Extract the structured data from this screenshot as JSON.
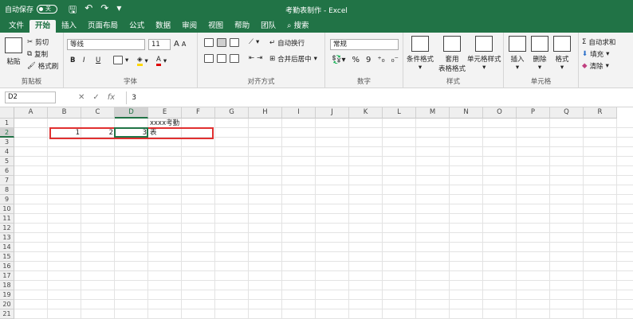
{
  "titlebar": {
    "autosave": "自动保存",
    "toggle": "关",
    "title": "考勤表制作 - Excel"
  },
  "tabs": [
    "文件",
    "开始",
    "插入",
    "页面布局",
    "公式",
    "数据",
    "审阅",
    "视图",
    "帮助",
    "团队",
    "搜索"
  ],
  "clipboard": {
    "paste": "粘贴",
    "cut": "剪切",
    "copy": "复制",
    "painter": "格式刷",
    "label": "剪贴板"
  },
  "font": {
    "name": "等线",
    "size": "11",
    "bold": "B",
    "italic": "I",
    "underline": "U",
    "grow": "A",
    "shrink": "A",
    "label": "字体"
  },
  "align": {
    "wrap": "自动换行",
    "merge": "合并后居中",
    "label": "对齐方式"
  },
  "number": {
    "format": "常规",
    "percent": "%",
    "comma": "9",
    "label": "数字"
  },
  "styles": {
    "cond": "条件格式",
    "table1": "套用",
    "table2": "表格格式",
    "cellstyle": "单元格样式",
    "label": "样式"
  },
  "cells": {
    "insert": "插入",
    "delete": "删除",
    "format": "格式",
    "label": "单元格"
  },
  "editing": {
    "autosum": "自动求和",
    "fill": "填充",
    "clear": "清除"
  },
  "formulabar": {
    "namebox": "D2",
    "fx": "fx",
    "value": "3"
  },
  "columns": [
    "A",
    "B",
    "C",
    "D",
    "E",
    "F",
    "G",
    "H",
    "I",
    "J",
    "K",
    "L",
    "M",
    "N",
    "O",
    "P",
    "Q",
    "R"
  ],
  "rows": [
    "1",
    "2",
    "3",
    "4",
    "5",
    "6",
    "7",
    "8",
    "9",
    "10",
    "11",
    "12",
    "13",
    "14",
    "15",
    "16",
    "17",
    "18",
    "19",
    "20",
    "21"
  ],
  "cells_data": {
    "e1": "xxxx考勤表",
    "b2": "1",
    "c2": "2",
    "d2": "3"
  }
}
